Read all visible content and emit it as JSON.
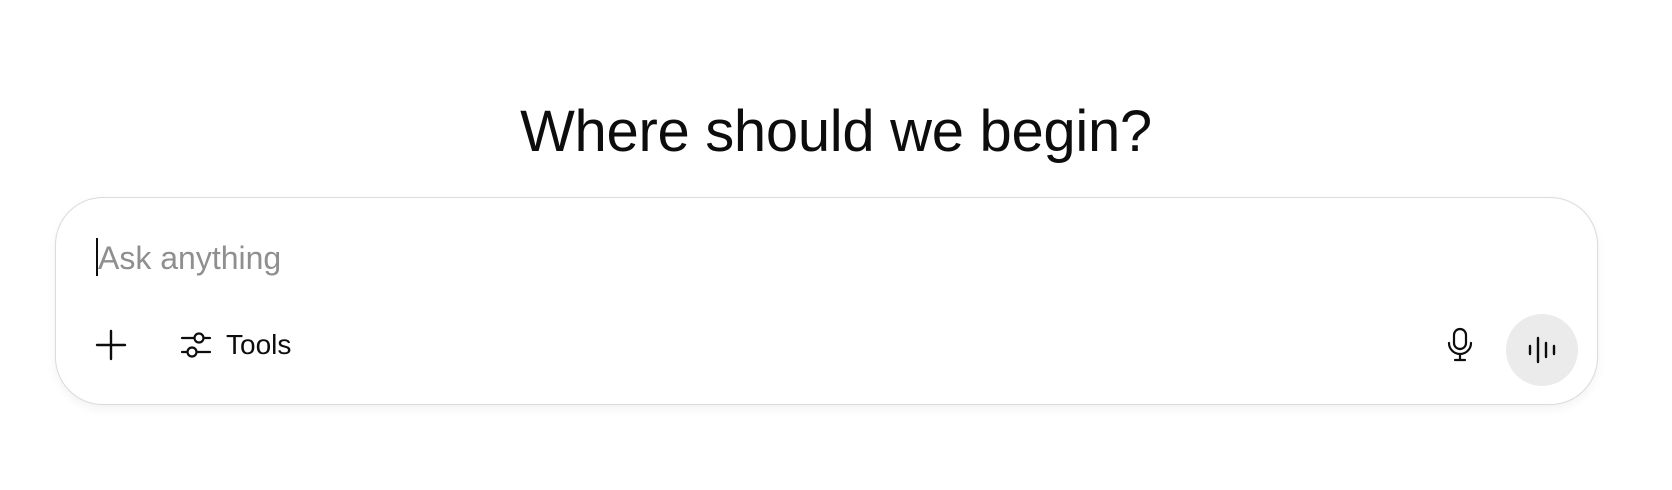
{
  "headline": "Where should we begin?",
  "composer": {
    "placeholder": "Ask anything",
    "value": ""
  },
  "toolbar": {
    "add_icon": "plus-icon",
    "tools_icon": "sliders-icon",
    "tools_label": "Tools",
    "mic_icon": "microphone-icon",
    "voice_icon": "voice-waveform-icon"
  },
  "colors": {
    "text": "#0d0d0d",
    "placeholder": "#8f8f8f",
    "border": "#dcdcdc",
    "voice_button_bg": "#ebebeb"
  }
}
